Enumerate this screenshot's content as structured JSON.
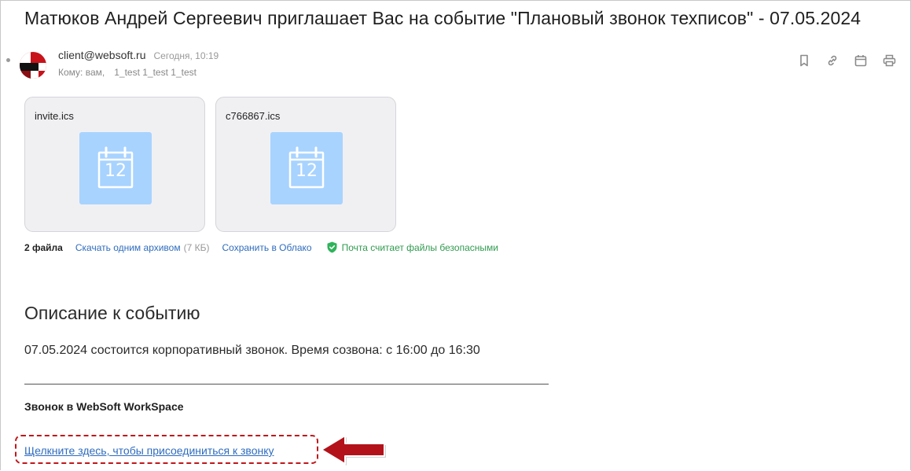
{
  "email": {
    "subject": "Матюков Андрей Сергеевич приглашает Вас на событие \"Плановый звонок техписов\" - 07.05.2024",
    "sender": "client@websoft.ru",
    "date": "Сегодня, 10:19",
    "recipients_label": "Кому: вам,",
    "recipients_names": "1_test 1_test 1_test"
  },
  "toolbar": {
    "icons": [
      "bookmark-icon",
      "link-icon",
      "calendar-icon",
      "print-icon"
    ]
  },
  "attachments": [
    {
      "name": "invite.ics",
      "day": "12"
    },
    {
      "name": "c766867.ics",
      "day": "12"
    }
  ],
  "filebar": {
    "count": "2 файла",
    "download_archive": "Скачать одним архивом",
    "archive_size": "(7 КБ)",
    "save_cloud": "Сохранить в Облако",
    "safe_text": "Почта считает файлы безопасными"
  },
  "body": {
    "heading": "Описание к событию",
    "text": "07.05.2024 состоится корпоративный звонок. Время созвона: с 16:00 до 16:30",
    "call_heading": "Звонок в WebSoft WorkSpace",
    "join_link": "Щелкните здесь, чтобы присоединиться к звонку"
  },
  "colors": {
    "link": "#2f6cbe",
    "safe": "#2f9b4e",
    "highlight": "#c0171b",
    "calendar_tile": "#a8d3ff"
  }
}
